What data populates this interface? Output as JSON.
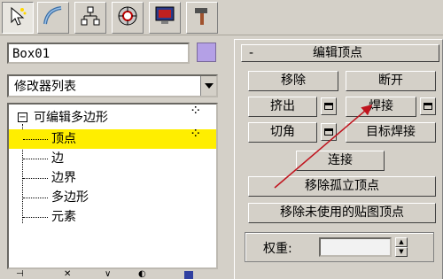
{
  "toolbar": {
    "tabs": [
      {
        "icon": "select-cursor-icon",
        "active": true
      },
      {
        "icon": "curve-icon"
      },
      {
        "icon": "hierarchy-icon"
      },
      {
        "icon": "motion-wheel-icon"
      },
      {
        "icon": "display-monitor-icon"
      },
      {
        "icon": "hammer-utilities-icon"
      }
    ]
  },
  "object": {
    "name": "Box01",
    "color": "#b4a0e6"
  },
  "modifier_list": {
    "selected": "修改器列表"
  },
  "stack": {
    "expand_symbol": "⊟",
    "root": "可编辑多边形",
    "items": [
      "顶点",
      "边",
      "边界",
      "多边形",
      "元素"
    ],
    "selected_index": 0,
    "selected_color": "#ffee00"
  },
  "rollout": {
    "collapse_symbol": "-",
    "title": "编辑顶点",
    "remove": "移除",
    "break": "断开",
    "extrude": "挤出",
    "weld": "焊接",
    "chamfer": "切角",
    "target_weld": "目标焊接",
    "connect": "连接",
    "remove_isolated": "移除孤立顶点",
    "remove_unused_map": "移除未使用的贴图顶点",
    "weight_label": "权重:"
  },
  "annotation": {
    "arrow_color": "#c0141e"
  }
}
